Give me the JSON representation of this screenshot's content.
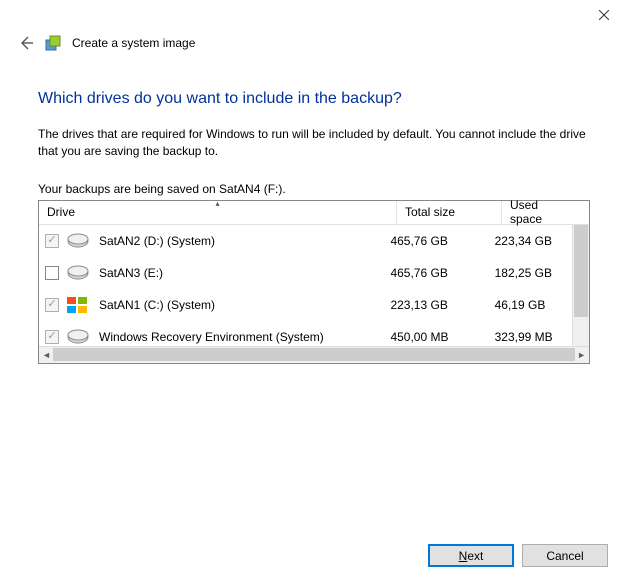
{
  "window": {
    "title": "Create a system image"
  },
  "page": {
    "heading": "Which drives do you want to include in the backup?",
    "description": "The drives that are required for Windows to run will be included by default. You cannot include the drive that you are saving the backup to.",
    "save_note": "Your backups are being saved on SatAN4 (F:)."
  },
  "columns": {
    "drive": "Drive",
    "total": "Total size",
    "used": "Used space"
  },
  "drives": [
    {
      "name": "SatAN2 (D:) (System)",
      "total": "465,76 GB",
      "used": "223,34 GB",
      "checked": true,
      "disabled": true,
      "os": false
    },
    {
      "name": "SatAN3 (E:)",
      "total": "465,76 GB",
      "used": "182,25 GB",
      "checked": false,
      "disabled": false,
      "os": false
    },
    {
      "name": "SatAN1 (C:) (System)",
      "total": "223,13 GB",
      "used": "46,19 GB",
      "checked": true,
      "disabled": true,
      "os": true
    },
    {
      "name": "Windows Recovery Environment (System)",
      "total": "450,00 MB",
      "used": "323,99 MB",
      "checked": true,
      "disabled": true,
      "os": false
    }
  ],
  "buttons": {
    "next": "Next",
    "cancel": "Cancel"
  }
}
